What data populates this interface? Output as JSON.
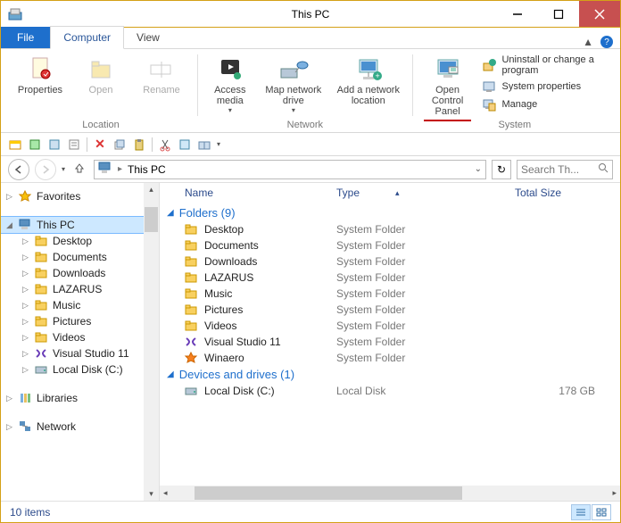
{
  "window": {
    "title": "This PC"
  },
  "tabs": {
    "file": "File",
    "computer": "Computer",
    "view": "View"
  },
  "ribbon": {
    "properties": "Properties",
    "open": "Open",
    "rename": "Rename",
    "group_location": "Location",
    "access_media": "Access media",
    "map_drive": "Map network drive",
    "add_location": "Add a network location",
    "group_network": "Network",
    "open_cp": "Open Control Panel",
    "uninstall": "Uninstall or change a program",
    "sys_props": "System properties",
    "manage": "Manage",
    "group_system": "System"
  },
  "nav": {
    "path": "This PC",
    "search_placeholder": "Search Th..."
  },
  "tree": {
    "favorites": "Favorites",
    "thispc": "This PC",
    "children": [
      "Desktop",
      "Documents",
      "Downloads",
      "LAZARUS",
      "Music",
      "Pictures",
      "Videos",
      "Visual Studio 11",
      "Local Disk (C:)"
    ],
    "libraries": "Libraries",
    "network": "Network"
  },
  "columns": {
    "name": "Name",
    "type": "Type",
    "total": "Total Size"
  },
  "groups": {
    "folders": {
      "label": "Folders (9)"
    },
    "devices": {
      "label": "Devices and drives (1)"
    }
  },
  "items": {
    "folders": [
      {
        "name": "Desktop",
        "type": "System Folder",
        "icon": "folder"
      },
      {
        "name": "Documents",
        "type": "System Folder",
        "icon": "folder"
      },
      {
        "name": "Downloads",
        "type": "System Folder",
        "icon": "folder"
      },
      {
        "name": "LAZARUS",
        "type": "System Folder",
        "icon": "folder"
      },
      {
        "name": "Music",
        "type": "System Folder",
        "icon": "folder"
      },
      {
        "name": "Pictures",
        "type": "System Folder",
        "icon": "folder"
      },
      {
        "name": "Videos",
        "type": "System Folder",
        "icon": "folder"
      },
      {
        "name": "Visual Studio 11",
        "type": "System Folder",
        "icon": "vs"
      },
      {
        "name": "Winaero",
        "type": "System Folder",
        "icon": "star"
      }
    ],
    "devices": [
      {
        "name": "Local Disk (C:)",
        "type": "Local Disk",
        "size": "178 GB",
        "icon": "disk"
      }
    ]
  },
  "status": {
    "count": "10 items"
  }
}
